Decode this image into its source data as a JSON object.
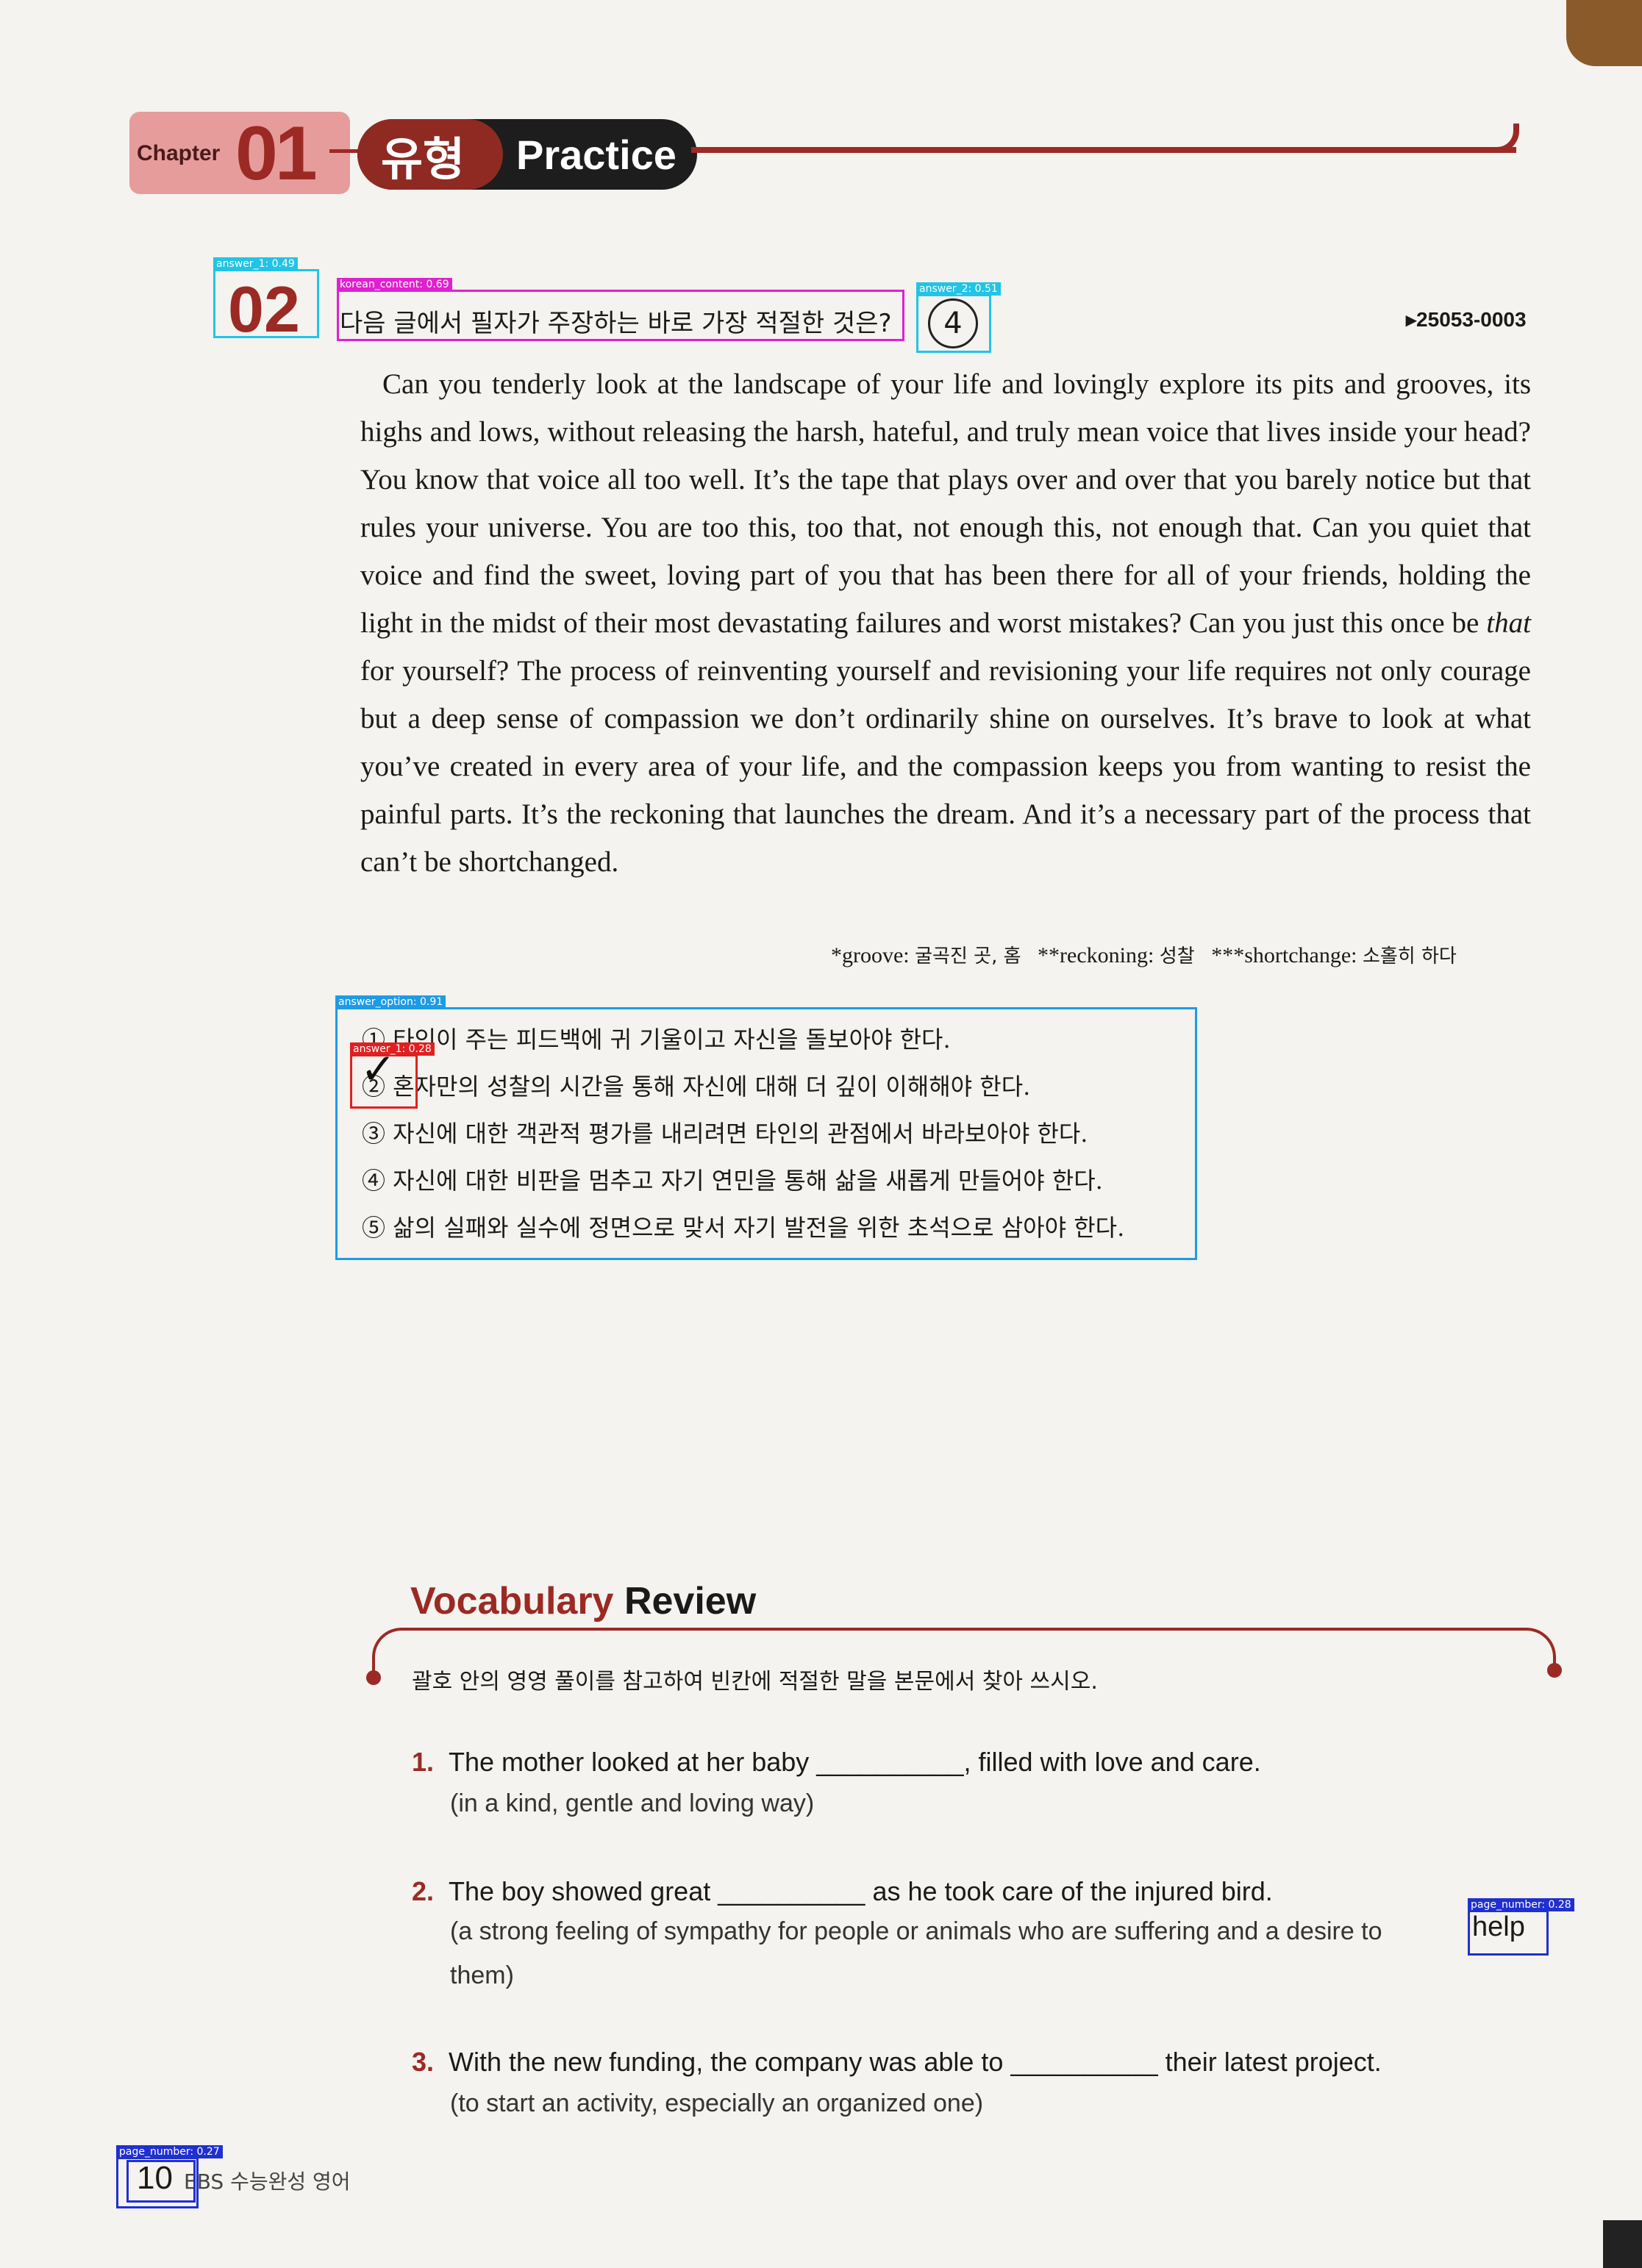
{
  "header": {
    "chapter_label": "Chapter",
    "chapter_number": "01",
    "type_korean": "유형",
    "type_english": "Practice"
  },
  "question": {
    "number": "02",
    "prompt": "다음 글에서 필자가 주장하는 바로 가장 적절한 것은?",
    "handwritten_answer": "4",
    "code": "▸25053-0003"
  },
  "passage": {
    "before": "Can you tenderly look at the landscape of your life and lovingly explore its pits and grooves, its highs and lows, without releasing the harsh, hateful, and truly mean voice that lives inside your head? You know that voice all too well. It’s the tape that plays over and over that you barely notice but that rules your universe. You are too this, too that, not enough this, not enough that. Can you quiet that voice and find the sweet, loving part of you that has been there for all of your friends, holding the light in the midst of their most devastating failures and worst mistakes? Can you just this once be ",
    "emphasis": "that",
    "after": " for yourself? The process of reinventing yourself and revisioning your life requires not only courage but a deep sense of compassion we don’t ordinarily shine on ourselves. It’s brave to look at what you’ve created in every area of your life, and the compassion keeps you from wanting to resist the painful parts. It’s the reckoning that launches the dream. And it’s a necessary part of the process that can’t be shortchanged."
  },
  "footnotes": [
    {
      "term": "*groove: ",
      "meaning": "굴곡진 곳, 홈"
    },
    {
      "term": "**reckoning: ",
      "meaning": "성찰"
    },
    {
      "term": "***shortchange: ",
      "meaning": "소홀히 하다"
    }
  ],
  "options": [
    "① 타인이 주는 피드백에 귀 기울이고 자신을 돌보아야 한다.",
    "② 혼자만의 성찰의 시간을 통해 자신에 대해 더 깊이 이해해야 한다.",
    "③ 자신에 대한 객관적 평가를 내리려면 타인의 관점에서 바라보아야 한다.",
    "④ 자신에 대한 비판을 멈추고 자기 연민을 통해 삶을 새롭게 만들어야 한다.",
    "⑤ 삶의 실패와 실수에 정면으로 맞서 자기 발전을 위한 초석으로 삼아야 한다."
  ],
  "check_mark": "✓",
  "vocab": {
    "title_colored": "Vocabulary",
    "title_rest": "Review",
    "instruction": "괄호 안의 영영 풀이를 참고하여 빈칸에 적절한 말을 본문에서 찾아 쓰시오.",
    "items": [
      {
        "n": "1.",
        "sentence": "The mother looked at her baby __________, filled with love and care.",
        "definition": "(in a kind, gentle and loving way)"
      },
      {
        "n": "2.",
        "sentence": "The boy showed great __________ as he took care of the injured bird.",
        "definition_line1": "(a strong feeling of sympathy for people or animals who are suffering and a desire to",
        "definition_word": "help",
        "definition_line2": "them)"
      },
      {
        "n": "3.",
        "sentence": "With the new funding, the company was able to __________ their latest project.",
        "definition": "(to start an activity, especially an organized one)"
      }
    ]
  },
  "footer": {
    "page_number": "10",
    "book_title": "EBS 수능완성 영어"
  },
  "detections": [
    {
      "label": "answer_1: 0.49",
      "color": "#22c4e6"
    },
    {
      "label": "korean_content: 0.69",
      "color": "#e020d0"
    },
    {
      "label": "answer_2: 0.51",
      "color": "#22c4e6"
    },
    {
      "label": "answer_option: 0.91",
      "color": "#1e9be6"
    },
    {
      "label": "answer_1: 0.28",
      "color": "#e02020"
    },
    {
      "label": "page_number: 0.28",
      "color": "#2030d0"
    },
    {
      "label": "page_number: 0.27",
      "color": "#2030d0"
    }
  ]
}
